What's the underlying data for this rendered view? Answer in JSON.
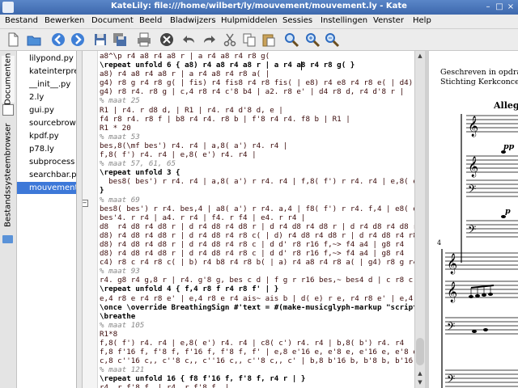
{
  "window": {
    "title": "KateLily: file:///home/wilbert/ly/mouvement/mouvement.ly - Kate"
  },
  "menu": [
    "Bestand",
    "Bewerken",
    "Document",
    "Beeld",
    "Bladwijzers",
    "Hulpmiddelen",
    "Sessies",
    "Instellingen",
    "Venster",
    "Help"
  ],
  "side_tabs": {
    "documents": "Documenten",
    "filesystem": "Bestandssysteembrowser"
  },
  "files": [
    "lilypond.py",
    "kateinterpre",
    "__init__.py",
    "2.ly",
    "gui.py",
    "sourcebrow",
    "kpdf.py",
    "p78.ly",
    "subprocess",
    "searchbar.p",
    "mouvement"
  ],
  "selected_file_index": 10,
  "editor_lines": [
    {
      "t": "a8^\\p r4 a8 r4 a8 r | a r4 a8 r4 r8 g(",
      "c": ""
    },
    {
      "t": "\\repeat unfold 6 { a8) r4 a8 r4 a8 r | a r4 a8 r4 r8 g( }",
      "c": "kw"
    },
    {
      "t": "a8) r4 a8 r4 a8 r | a r4 a8 r4 r8 a( |",
      "c": ""
    },
    {
      "t": "g4) r8 g r4 r8 g( | fis) r4 fis8 r4 r8 fis( | e8) r4 e8 r4 r8 e( | d4) r8",
      "c": ""
    },
    {
      "t": "g4) r8 r4. r8 g | c,4 r8 r4 c'8 b4 | a2. r8 e' | d4 r8 d, r4 d'8 r |",
      "c": ""
    },
    {
      "t": "% maat 25",
      "c": "cm"
    },
    {
      "t": "R1 | r4. r d8 d, | R1 | r4. r4 d'8 d, e |",
      "c": ""
    },
    {
      "t": "f4 r8 r4. r8 f | b8 r4 r4. r8 b | f'8 r4 r4. f8 b | R1 |",
      "c": ""
    },
    {
      "t": "R1 * 20",
      "c": ""
    },
    {
      "t": "% maat 53",
      "c": "cm"
    },
    {
      "t": "bes,8(\\mf bes') r4. r4 | a,8( a') r4. r4 |",
      "c": ""
    },
    {
      "t": "f,8( f') r4. r4 | e,8( e') r4. r4 |",
      "c": ""
    },
    {
      "t": "% maat 57, 61, 65",
      "c": "cm"
    },
    {
      "t": "\\repeat unfold 3 {",
      "c": "kw"
    },
    {
      "t": "  bes8( bes') r r4. r4 | a,8( a') r r4. r4 | f,8( f') r r4. r4 | e,8( e')",
      "c": ""
    },
    {
      "t": "}",
      "c": "kw"
    },
    {
      "t": "% maat 69",
      "c": "cm"
    },
    {
      "t": "bes8( bes') r r4. bes,4 | a8( a') r r4. a,4 | f8( f') r r4. f,4 | e8( e')",
      "c": ""
    },
    {
      "t": "bes'4. r r4 | a4. r r4 | f4. r f4 | e4. r r4 |",
      "c": ""
    },
    {
      "t": "d8  r4 d8 r4 d8 r | d r4 d8 r4 d8 r | d r4 d8 r4 d8 r | d r4 d8 r4 d8 r",
      "c": ""
    },
    {
      "t": "d8) r4 d8 r4 d8 r | d r4 d8 r4 r8 c( | d) r4 d8 r4 d8 r | d r4 d8 r4 r8",
      "c": ""
    },
    {
      "t": "d8) r4 d8 r4 d8 r | d r4 d8 r4 r8 c | d d' r8 r16 f,~> f4 a4 | g8 r4",
      "c": ""
    },
    {
      "t": "d8) r4 d8 r4 d8 r | d r4 d8 r4 r8 c | d d' r8 r16 f,~> f4 a4 | g8 r4",
      "c": ""
    },
    {
      "t": "c4) r8 c r4 r8 c( | b) r4 b8 r4 r8 b( | a) r4 a8 r4 r8 a( | g4) r8 g r4",
      "c": ""
    },
    {
      "t": "% maat 93",
      "c": "cm"
    },
    {
      "t": "r4. g8 r4 g,8 r | r4. g'8 g, bes c d | f g r r16 bes,~ bes4 d | c r8 c",
      "c": ""
    },
    {
      "t": "\\repeat unfold 4 { f,4 r8 f r4 r8 f' | }",
      "c": "kw"
    },
    {
      "t": "e,4 r8 e r4 r8 e' | e,4 r8 e r4 ais~ ais b | d( e) r e, r4 r8 e' | e,4",
      "c": ""
    },
    {
      "t": "\\once \\override BreathingSign #'text = #(make-musicglyph-markup \"scripts",
      "c": "kw"
    },
    {
      "t": "\\breathe",
      "c": "kw"
    },
    {
      "t": "% maat 105",
      "c": "cm"
    },
    {
      "t": "R1*8",
      "c": ""
    },
    {
      "t": "f,8( f') r4. r4 | e,8( e') r4. r4 | c8( c') r4. r4 | b,8( b') r4. r4",
      "c": ""
    },
    {
      "t": "f,8 f'16 f, f'8 f, f'16 f, f'8 f, f' | e,8 e'16 e, e'8 e, e'16 e, e'8 e,",
      "c": ""
    },
    {
      "t": "c,8 c''16 c,, c''8 c,, c''16 c,, c''8 c,, c' | b,8 b'16 b, b'8 b, b'16 b, b'8",
      "c": ""
    },
    {
      "t": "% maat 121",
      "c": "cm"
    },
    {
      "t": "\\repeat unfold 16 { f8 f'16 f, f'8 f, r4 r | }",
      "c": "kw"
    },
    {
      "t": "r4. r f'8 f, | r4. r f'8 f, |",
      "c": ""
    }
  ],
  "pdf": {
    "line1": "Geschreven in opdracht",
    "line2": "Stichting Kerkconcerten",
    "tempo": "Alleg",
    "dyn1": "pp",
    "dyn2": "p",
    "measure": "4"
  },
  "colors": {
    "accent": "#3d78d8",
    "titlebar": "#4a76bc",
    "keyword": "#000000",
    "note_text": "#3b0b0b",
    "comment": "#888888"
  },
  "toolbar_icons": [
    "new-icon",
    "open-icon",
    "back-icon",
    "forward-icon",
    "save-icon",
    "save-all-icon",
    "print-icon",
    "close-doc-icon",
    "undo-icon",
    "redo-icon",
    "cut-icon",
    "copy-icon",
    "paste-icon",
    "find-icon",
    "zoom-in-icon",
    "zoom-out-icon"
  ]
}
